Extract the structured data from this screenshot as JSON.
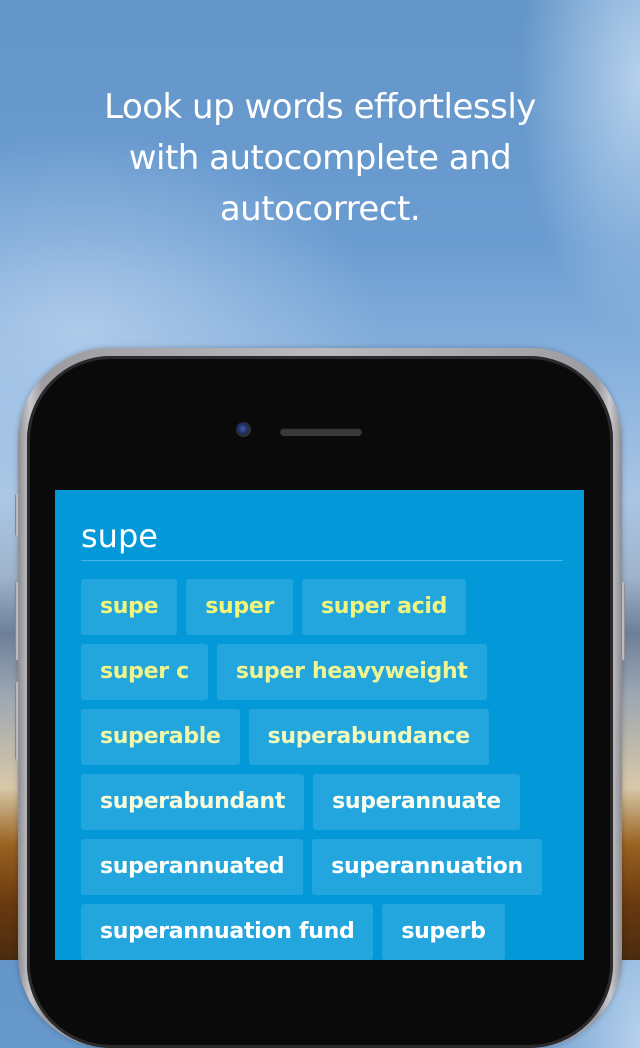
{
  "headline": {
    "lines": [
      "Look up words effortlessly",
      "with autocomplete and",
      "autocorrect."
    ]
  },
  "search": {
    "value": "supe",
    "placeholder": ""
  },
  "suggestions": [
    {
      "label": "supe",
      "color": "#f2f57a"
    },
    {
      "label": "super",
      "color": "#f2f57a"
    },
    {
      "label": "super acid",
      "color": "#f0f47f"
    },
    {
      "label": "super c",
      "color": "#eff58a"
    },
    {
      "label": "super heavyweight",
      "color": "#eef592"
    },
    {
      "label": "superable",
      "color": "#f0f7a8"
    },
    {
      "label": "superabundance",
      "color": "#f2f9bd"
    },
    {
      "label": "superabundant",
      "color": "#f7fbdc"
    },
    {
      "label": "superannuate",
      "color": "#fbfdee"
    },
    {
      "label": "superannuated",
      "color": "#fdfef7"
    },
    {
      "label": "superannuation",
      "color": "#ffffff"
    },
    {
      "label": "superannuation fund",
      "color": "#ffffff"
    },
    {
      "label": "superb",
      "color": "#ffffff"
    }
  ],
  "colors": {
    "screen_bg": "#0399d9",
    "highlight_text": "#f2f57a"
  }
}
